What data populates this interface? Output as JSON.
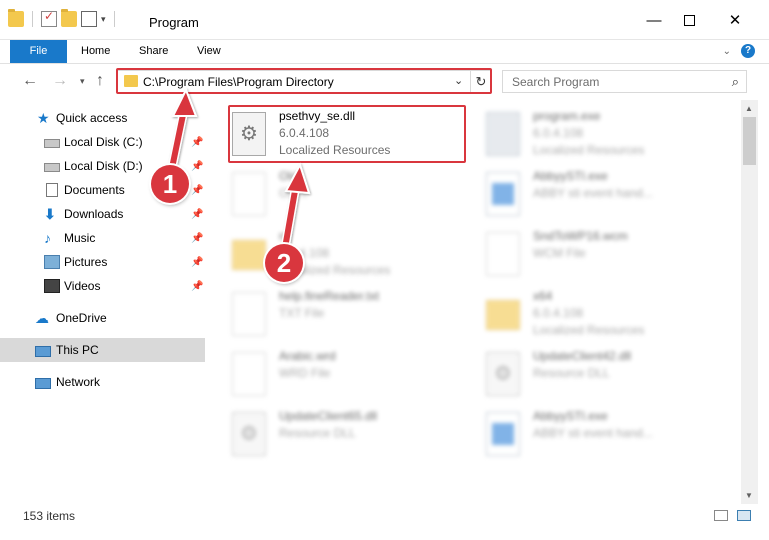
{
  "window": {
    "title": "Program",
    "minimize_glyph": "—",
    "close_glyph": "✕"
  },
  "ribbon": {
    "tabs": [
      "File",
      "Home",
      "Share",
      "View"
    ],
    "help": "?"
  },
  "address": {
    "path": "C:\\Program Files\\Program Directory",
    "search_placeholder": "Search Program"
  },
  "nav": {
    "items": [
      {
        "label": "Quick access",
        "icon": "star-icon"
      },
      {
        "label": "Local Disk (C:)",
        "icon": "disk-icon",
        "pinned": true
      },
      {
        "label": "Local Disk (D:)",
        "icon": "disk-icon",
        "pinned": true
      },
      {
        "label": "Documents",
        "icon": "documents-icon",
        "pinned": true
      },
      {
        "label": "Downloads",
        "icon": "downloads-icon",
        "pinned": true
      },
      {
        "label": "Music",
        "icon": "music-icon",
        "pinned": true
      },
      {
        "label": "Pictures",
        "icon": "pictures-icon",
        "pinned": true
      },
      {
        "label": "Videos",
        "icon": "videos-icon",
        "pinned": true
      },
      {
        "label": "OneDrive",
        "icon": "onedrive-icon"
      },
      {
        "label": "This PC",
        "icon": "this-pc-icon",
        "selected": true
      },
      {
        "label": "Network",
        "icon": "network-icon"
      }
    ]
  },
  "files": [
    {
      "name": "psethvy_se.dll",
      "line1": "6.0.4.108",
      "line2": "Localized Resources",
      "icon": "dll-file-icon",
      "highlighted": true
    },
    {
      "name": "program.exe",
      "line1": "6.0.4.108",
      "line2": "Localized Resources",
      "icon": "exe-file-icon"
    },
    {
      "name": "Old",
      "line1": "Old fi",
      "line2": "",
      "icon": "file-icon"
    },
    {
      "name": "AbbyySTI.exe",
      "line1": "ABBY sti event hand...",
      "line2": "",
      "icon": "exe-file-icon"
    },
    {
      "name": "ru",
      "line1": "6.0.4.108",
      "line2": "Localized Resources",
      "icon": "folder-icon"
    },
    {
      "name": "SndToWP16.wcm",
      "line1": "WCM File",
      "line2": "",
      "icon": "file-icon"
    },
    {
      "name": "help.fineReader.txt",
      "line1": "TXT File",
      "line2": "",
      "icon": "file-icon"
    },
    {
      "name": "x64",
      "line1": "6.0.4.108",
      "line2": "Localized Resources",
      "icon": "folder-icon"
    },
    {
      "name": "Arabic.wrd",
      "line1": "WRD File",
      "line2": "",
      "icon": "file-icon"
    },
    {
      "name": "UpdateClient42.dll",
      "line1": "Resource DLL",
      "line2": "",
      "icon": "dll-file-icon"
    },
    {
      "name": "UpdateClient65.dll",
      "line1": "Resource DLL",
      "line2": "",
      "icon": "dll-file-icon"
    },
    {
      "name": "AbbyySTI.exe",
      "line1": "ABBY sti event hand...",
      "line2": "",
      "icon": "exe-file-icon"
    }
  ],
  "status": {
    "item_count": "153 items"
  },
  "callouts": {
    "one": "1",
    "two": "2"
  },
  "colors": {
    "accent": "#1979ca",
    "highlight_red": "#d9363e"
  }
}
